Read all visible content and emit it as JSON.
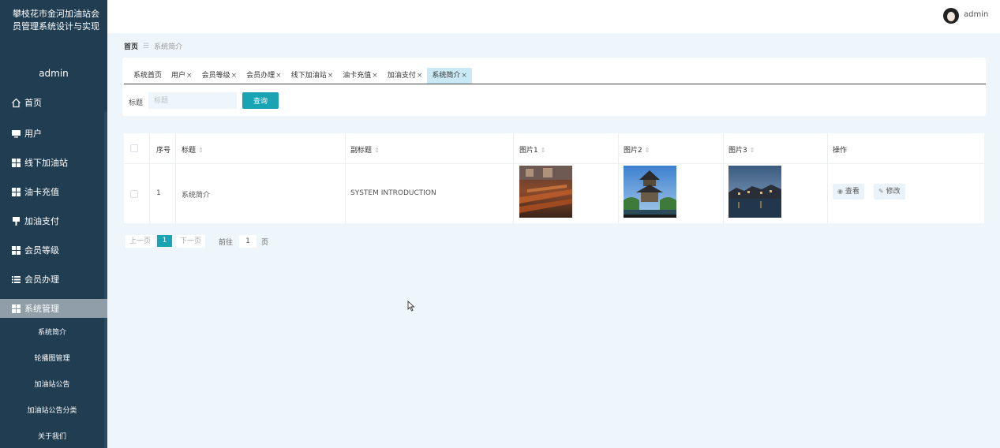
{
  "sidebar": {
    "app_title": "攀枝花市金河加油站会员管理系统设计与实现",
    "user": "admin",
    "items": [
      {
        "label": "首页",
        "icon": "home-icon"
      },
      {
        "label": "用户",
        "icon": "monitor-icon"
      },
      {
        "label": "线下加油站",
        "icon": "grid-icon"
      },
      {
        "label": "油卡充值",
        "icon": "grid-icon"
      },
      {
        "label": "加油支付",
        "icon": "pin-icon"
      },
      {
        "label": "会员等级",
        "icon": "grid-icon"
      },
      {
        "label": "会员办理",
        "icon": "list-icon"
      },
      {
        "label": "系统管理",
        "icon": "grid-icon"
      }
    ],
    "sub_items": [
      "系统简介",
      "轮播图管理",
      "加油站公告",
      "加油站公告分类",
      "关于我们"
    ]
  },
  "header": {
    "username": "admin"
  },
  "breadcrumb": {
    "home": "首页",
    "current": "系统简介"
  },
  "tabs": [
    {
      "label": "系统首页",
      "closable": false
    },
    {
      "label": "用户",
      "closable": true
    },
    {
      "label": "会员等级",
      "closable": true
    },
    {
      "label": "会员办理",
      "closable": true
    },
    {
      "label": "线下加油站",
      "closable": true
    },
    {
      "label": "油卡充值",
      "closable": true
    },
    {
      "label": "加油支付",
      "closable": true
    },
    {
      "label": "系统简介",
      "closable": true,
      "active": true
    }
  ],
  "search": {
    "label": "标题",
    "placeholder": "标题",
    "button": "查询"
  },
  "table": {
    "headers": {
      "index": "序号",
      "title": "标题",
      "subtitle": "副标题",
      "pic1": "图片1",
      "pic2": "图片2",
      "pic3": "图片3",
      "actions": "操作"
    },
    "rows": [
      {
        "index": "1",
        "title": "系统简介",
        "subtitle": "SYSTEM INTRODUCTION",
        "view": "查看",
        "edit": "修改"
      }
    ]
  },
  "pagination": {
    "prev": "上一页",
    "current": "1",
    "next": "下一页",
    "goto": "前往",
    "page_input": "1",
    "page_suffix": "页"
  },
  "colors": {
    "sidebar_bg": "#203d52",
    "accent": "#1aa3b2",
    "page_bg": "#eef5fb",
    "active_tab": "#c9eaf5"
  }
}
